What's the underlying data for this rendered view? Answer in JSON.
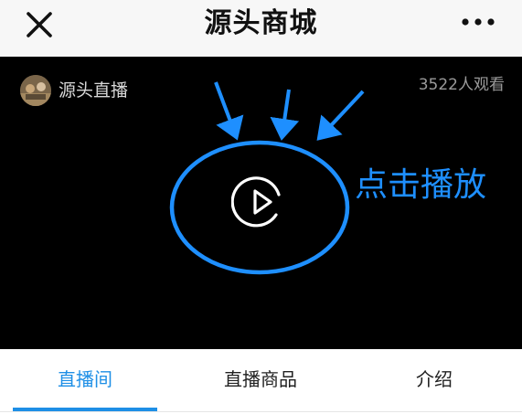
{
  "header": {
    "title": "源头商城",
    "close_icon": "close-icon",
    "more_icon": "more-dots-icon"
  },
  "video": {
    "host_name": "源头直播",
    "viewer_count": "3522人观看",
    "play_icon": "play-circle-icon",
    "background_color": "#000000"
  },
  "annotation": {
    "label": "点击播放",
    "color": "#1e8fff"
  },
  "tabs": [
    {
      "label": "直播间",
      "active": true
    },
    {
      "label": "直播商品",
      "active": false
    },
    {
      "label": "介绍",
      "active": false
    }
  ],
  "colors": {
    "accent": "#1e8fe6",
    "header_bg": "#f7f7f7"
  }
}
